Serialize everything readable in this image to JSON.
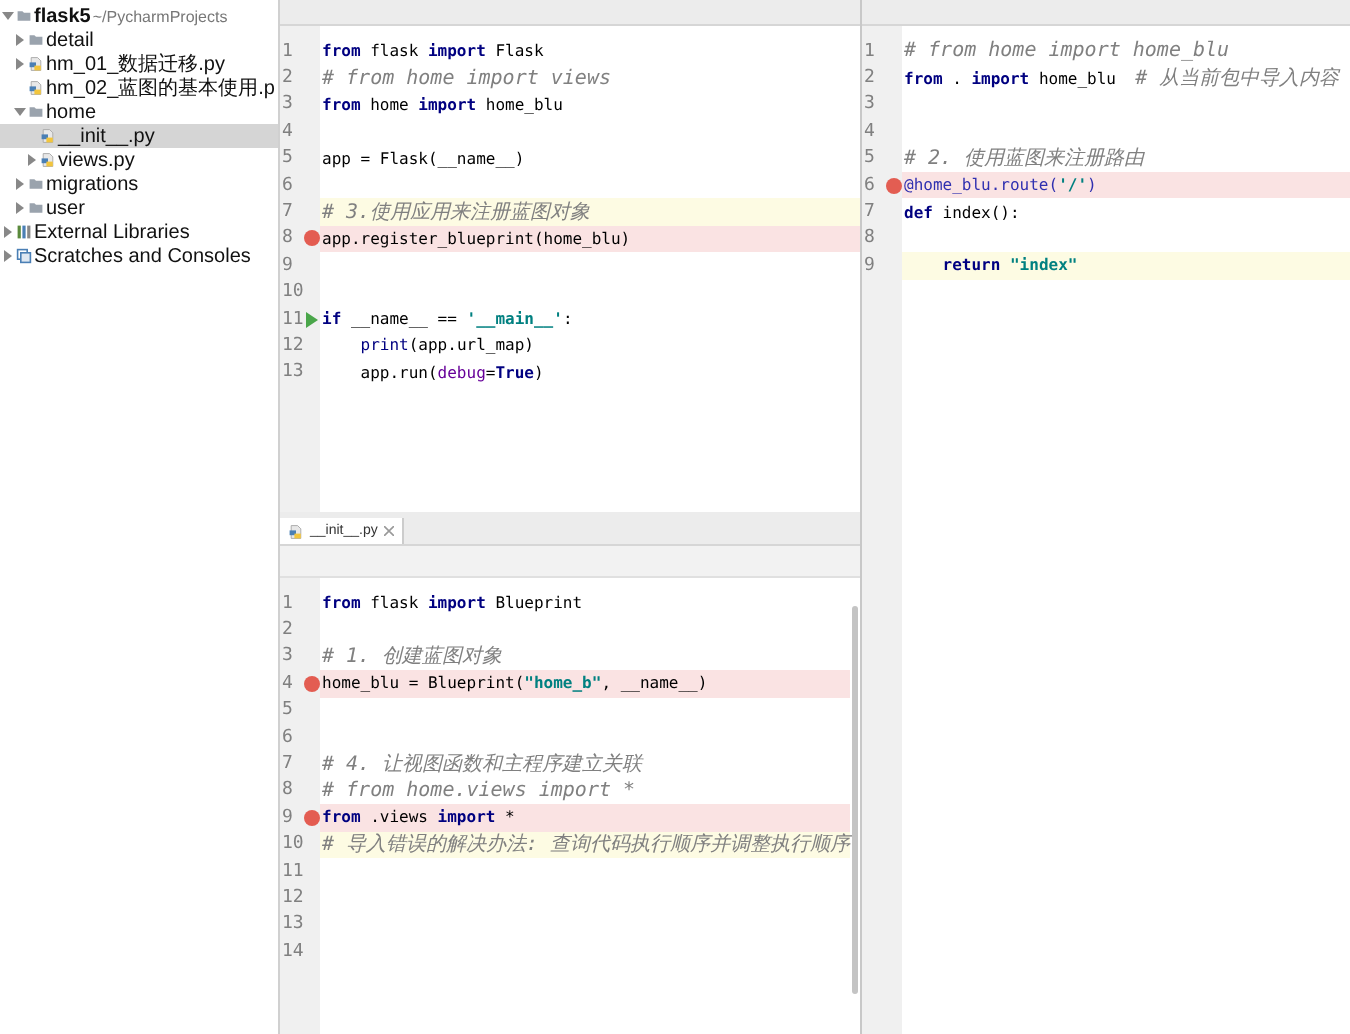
{
  "sidebar": {
    "items": [
      {
        "label": "flask5",
        "path": "~/PycharmProjects",
        "kind": "project",
        "expanded": true,
        "selected": false,
        "children": [
          {
            "label": "detail",
            "kind": "folder",
            "expanded": false,
            "selected": false
          },
          {
            "label": "hm_01_数据迁移.py",
            "kind": "python",
            "expanded": false,
            "selected": false
          },
          {
            "label": "hm_02_蓝图的基本使用.p",
            "kind": "python",
            "selected": false
          },
          {
            "label": "home",
            "kind": "folder",
            "expanded": true,
            "selected": false,
            "children": [
              {
                "label": "__init__.py",
                "kind": "python",
                "selected": true
              },
              {
                "label": "views.py",
                "kind": "python",
                "expanded": false,
                "selected": false
              }
            ]
          },
          {
            "label": "migrations",
            "kind": "folder",
            "expanded": false,
            "selected": false
          },
          {
            "label": "user",
            "kind": "folder",
            "expanded": false,
            "selected": false
          }
        ]
      },
      {
        "label": "External Libraries",
        "kind": "library",
        "expanded": false,
        "selected": false
      },
      {
        "label": "Scratches and Consoles",
        "kind": "scratches",
        "expanded": false,
        "selected": false
      }
    ]
  },
  "left_top_editor": {
    "lines": [
      {
        "number": "1",
        "breakpoint": false,
        "current": false,
        "tokens": [
          {
            "kind": "kw",
            "text": "from"
          },
          {
            "kind": "plain",
            "text": " flask "
          },
          {
            "kind": "kw",
            "text": "import"
          },
          {
            "kind": "plain",
            "text": " Flask"
          }
        ]
      },
      {
        "number": "2",
        "breakpoint": false,
        "current": false,
        "tokens": [
          {
            "kind": "comment",
            "text": "# from home import views"
          }
        ]
      },
      {
        "number": "3",
        "breakpoint": false,
        "current": false,
        "tokens": [
          {
            "kind": "kw",
            "text": "from"
          },
          {
            "kind": "plain",
            "text": " home "
          },
          {
            "kind": "kw",
            "text": "import"
          },
          {
            "kind": "plain",
            "text": " home_blu"
          }
        ]
      },
      {
        "number": "4",
        "breakpoint": false,
        "current": false
      },
      {
        "number": "5",
        "breakpoint": false,
        "current": false,
        "tokens": [
          {
            "kind": "plain",
            "text": "app = Flask(__name__)"
          }
        ]
      },
      {
        "number": "6",
        "breakpoint": false,
        "current": false
      },
      {
        "number": "7",
        "breakpoint": false,
        "current": true,
        "tokens": [
          {
            "kind": "comment",
            "text": "# 3.使用应用来注册蓝图对象"
          }
        ]
      },
      {
        "number": "8",
        "breakpoint": true,
        "current": false,
        "tokens": [
          {
            "kind": "plain",
            "text": "app.register_blueprint(home_blu)"
          }
        ]
      },
      {
        "number": "9",
        "breakpoint": false,
        "current": false
      },
      {
        "number": "10",
        "breakpoint": false,
        "current": false
      },
      {
        "number": "11",
        "breakpoint": false,
        "run": true,
        "current": false,
        "tokens": [
          {
            "kind": "kw",
            "text": "if"
          },
          {
            "kind": "plain",
            "text": " __name__ == "
          },
          {
            "kind": "string",
            "text": "'__main__'"
          },
          {
            "kind": "plain",
            "text": ":"
          }
        ]
      },
      {
        "number": "12",
        "breakpoint": false,
        "current": false,
        "tokens": [
          {
            "kind": "builtin",
            "text": "    print"
          },
          {
            "kind": "plain",
            "text": "(app.url_map)"
          }
        ]
      },
      {
        "number": "13",
        "breakpoint": false,
        "current": false,
        "tokens": [
          {
            "kind": "plain",
            "text": "    app.run("
          },
          {
            "kind": "param",
            "text": "debug"
          },
          {
            "kind": "plain",
            "text": "="
          },
          {
            "kind": "kw",
            "text": "True"
          },
          {
            "kind": "plain",
            "text": ")"
          }
        ]
      }
    ]
  },
  "left_bottom_editor": {
    "tab": {
      "label": "__init__.py",
      "selected": true
    },
    "lines": [
      {
        "number": "1",
        "breakpoint": false,
        "current": false,
        "tokens": [
          {
            "kind": "kw",
            "text": "from"
          },
          {
            "kind": "plain",
            "text": " flask "
          },
          {
            "kind": "kw",
            "text": "import"
          },
          {
            "kind": "plain",
            "text": " Blueprint"
          }
        ]
      },
      {
        "number": "2",
        "breakpoint": false,
        "current": false
      },
      {
        "number": "3",
        "breakpoint": false,
        "current": false,
        "tokens": [
          {
            "kind": "comment",
            "text": "# 1. 创建蓝图对象"
          }
        ]
      },
      {
        "number": "4",
        "breakpoint": true,
        "current": false,
        "tokens": [
          {
            "kind": "plain",
            "text": "home_blu = Blueprint("
          },
          {
            "kind": "string",
            "text": "\"home_b\""
          },
          {
            "kind": "plain",
            "text": ", __name__)"
          }
        ]
      },
      {
        "number": "5",
        "breakpoint": false,
        "current": false
      },
      {
        "number": "6",
        "breakpoint": false,
        "current": false
      },
      {
        "number": "7",
        "breakpoint": false,
        "current": false,
        "tokens": [
          {
            "kind": "comment",
            "text": "# 4. 让视图函数和主程序建立关联"
          }
        ]
      },
      {
        "number": "8",
        "breakpoint": false,
        "current": false,
        "tokens": [
          {
            "kind": "comment",
            "text": "# from home.views import *"
          }
        ]
      },
      {
        "number": "9",
        "breakpoint": true,
        "current": false,
        "tokens": [
          {
            "kind": "kw",
            "text": "from"
          },
          {
            "kind": "plain",
            "text": " .views "
          },
          {
            "kind": "kw",
            "text": "import"
          },
          {
            "kind": "plain",
            "text": " *"
          }
        ]
      },
      {
        "number": "10",
        "breakpoint": false,
        "current": true,
        "tokens": [
          {
            "kind": "comment",
            "text": "# 导入错误的解决办法: 查询代码执行顺序并调整执行顺序"
          }
        ]
      },
      {
        "number": "11",
        "breakpoint": false,
        "current": false
      },
      {
        "number": "12",
        "breakpoint": false,
        "current": false
      },
      {
        "number": "13",
        "breakpoint": false,
        "current": false
      },
      {
        "number": "14",
        "breakpoint": false,
        "current": false
      }
    ]
  },
  "right_editor": {
    "lines": [
      {
        "number": "1",
        "breakpoint": false,
        "current": false,
        "tokens": [
          {
            "kind": "comment",
            "text": "# from home import home_blu"
          }
        ]
      },
      {
        "number": "2",
        "breakpoint": false,
        "current": false,
        "tokens": [
          {
            "kind": "kw",
            "text": "from"
          },
          {
            "kind": "plain",
            "text": " . "
          },
          {
            "kind": "kw",
            "text": "import"
          },
          {
            "kind": "plain",
            "text": " home_blu  "
          },
          {
            "kind": "comment",
            "text": "# 从当前包中导入内容"
          }
        ]
      },
      {
        "number": "3",
        "breakpoint": false,
        "current": false
      },
      {
        "number": "4",
        "breakpoint": false,
        "current": false
      },
      {
        "number": "5",
        "breakpoint": false,
        "current": false,
        "tokens": [
          {
            "kind": "comment",
            "text": "# 2. 使用蓝图来注册路由"
          }
        ]
      },
      {
        "number": "6",
        "breakpoint": true,
        "current": false,
        "tokens": [
          {
            "kind": "decorator",
            "text": "@home_blu.route("
          },
          {
            "kind": "string",
            "text": "'/'"
          },
          {
            "kind": "decorator",
            "text": ")"
          }
        ]
      },
      {
        "number": "7",
        "breakpoint": false,
        "current": false,
        "tokens": [
          {
            "kind": "kw",
            "text": "def"
          },
          {
            "kind": "plain",
            "text": " index():"
          }
        ]
      },
      {
        "number": "8",
        "breakpoint": false,
        "current": false
      },
      {
        "number": "9",
        "breakpoint": false,
        "current": true,
        "tokens": [
          {
            "kind": "kw",
            "text": "    return"
          },
          {
            "kind": "string",
            "text": " \"index\""
          }
        ]
      }
    ]
  }
}
